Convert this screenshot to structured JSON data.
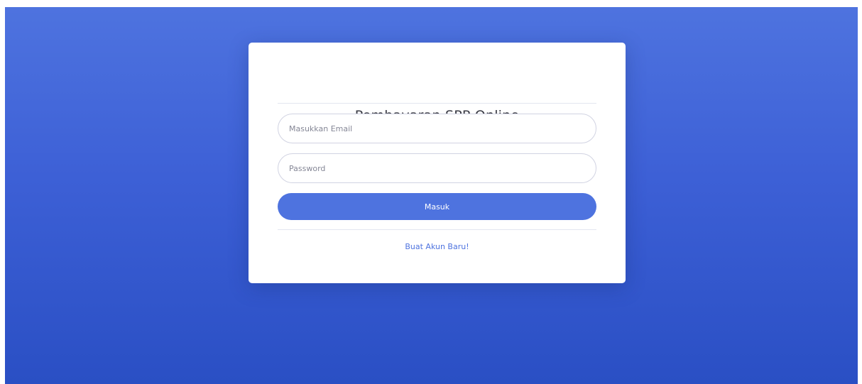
{
  "login": {
    "title": "Pembayaran SPP Online",
    "email_placeholder": "Masukkan Email",
    "email_value": "",
    "password_placeholder": "Password",
    "password_value": "",
    "submit_label": "Masuk",
    "register_link": "Buat Akun Baru!"
  },
  "colors": {
    "primary": "#4e73df",
    "background_top": "#4e73df",
    "background_bottom": "#2a4fc4",
    "card": "#ffffff",
    "title_text": "#3a3b45"
  }
}
